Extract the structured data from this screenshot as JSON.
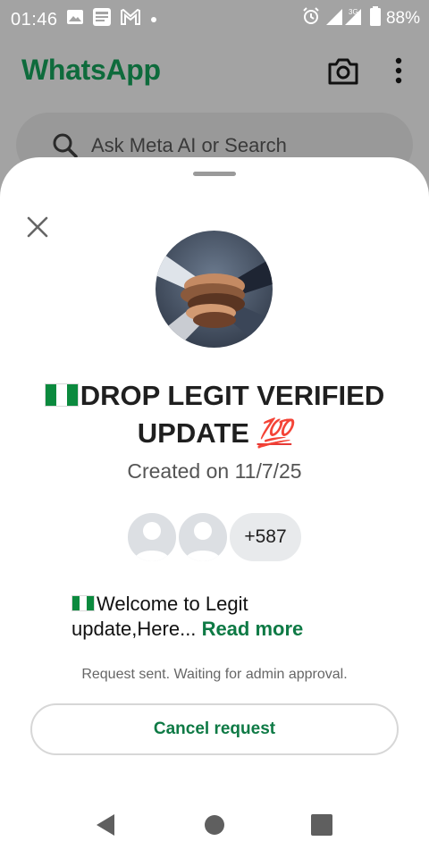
{
  "status_bar": {
    "time": "01:46",
    "network": "3G",
    "battery": "88%"
  },
  "header": {
    "app_title": "WhatsApp"
  },
  "search": {
    "placeholder": "Ask Meta AI or Search"
  },
  "sheet": {
    "group_name_line1": "DROP LEGIT VERIFIED",
    "group_name_line2": "UPDATE",
    "group_name_emoji": "💯",
    "created_on": "Created on 11/7/25",
    "member_count": "+587",
    "description": "Welcome to Legit update,Here...",
    "read_more": "Read more",
    "request_status": "Request sent. Waiting for admin approval.",
    "cancel_button": "Cancel request"
  },
  "colors": {
    "brand_green": "#0e6b3c",
    "link_green": "#0e7a45",
    "scrim_gray": "#a3a3a3"
  },
  "icons": [
    "image-icon",
    "news-icon",
    "gmail-icon",
    "dot-icon",
    "alarm-icon",
    "signal-icon",
    "battery-icon",
    "camera-icon",
    "more-vert-icon",
    "search-icon",
    "close-icon",
    "back-icon",
    "home-icon",
    "recents-icon"
  ]
}
